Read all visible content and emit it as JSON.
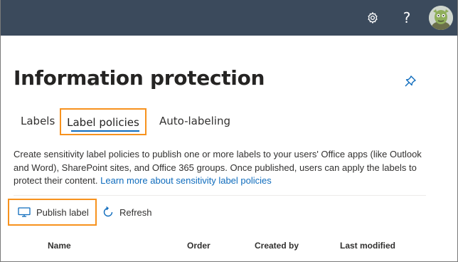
{
  "header": {
    "settings_icon": "gear-icon",
    "help_label": "?",
    "avatar_icon": "user-avatar"
  },
  "page": {
    "title": "Information protection",
    "pin_icon": "pin-icon"
  },
  "tabs": [
    {
      "label": "Labels",
      "selected": false
    },
    {
      "label": "Label policies",
      "selected": true
    },
    {
      "label": "Auto-labeling",
      "selected": false
    }
  ],
  "description": {
    "text": "Create sensitivity label policies to publish one or more labels to your users' Office apps (like Outlook and Word), SharePoint sites, and Office 365 groups. Once published, users can apply the labels to protect their content.",
    "link_text": "Learn more about sensitivity label policies"
  },
  "toolbar": {
    "publish_label": "Publish label",
    "refresh_label": "Refresh"
  },
  "table": {
    "columns": [
      "Name",
      "Order",
      "Created by",
      "Last modified"
    ]
  },
  "colors": {
    "topbar": "#3b4a5c",
    "accent": "#0f6cbd",
    "highlight": "#f7921e"
  }
}
